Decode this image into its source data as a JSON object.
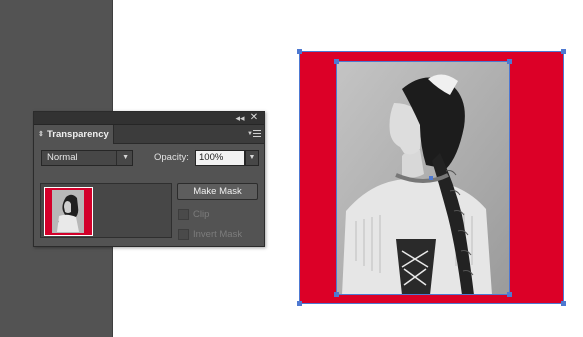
{
  "panel": {
    "collapse_icon": "collapse-arrows-icon",
    "close_icon": "close-icon",
    "tab_label": "Transparency",
    "menu_icon": "panel-menu-icon",
    "blend_mode": {
      "value": "Normal",
      "icon": "chevron-down-icon"
    },
    "opacity": {
      "label": "Opacity:",
      "value": "100%",
      "icon": "chevron-down-icon"
    },
    "make_mask_label": "Make Mask",
    "options": {
      "clip_label": "Clip",
      "invert_mask_label": "Invert Mask"
    }
  },
  "artwork": {
    "background_color": "#dc0027",
    "selection_color": "#4e79d1",
    "photo": "black-and-white portrait of a woman in profile"
  }
}
